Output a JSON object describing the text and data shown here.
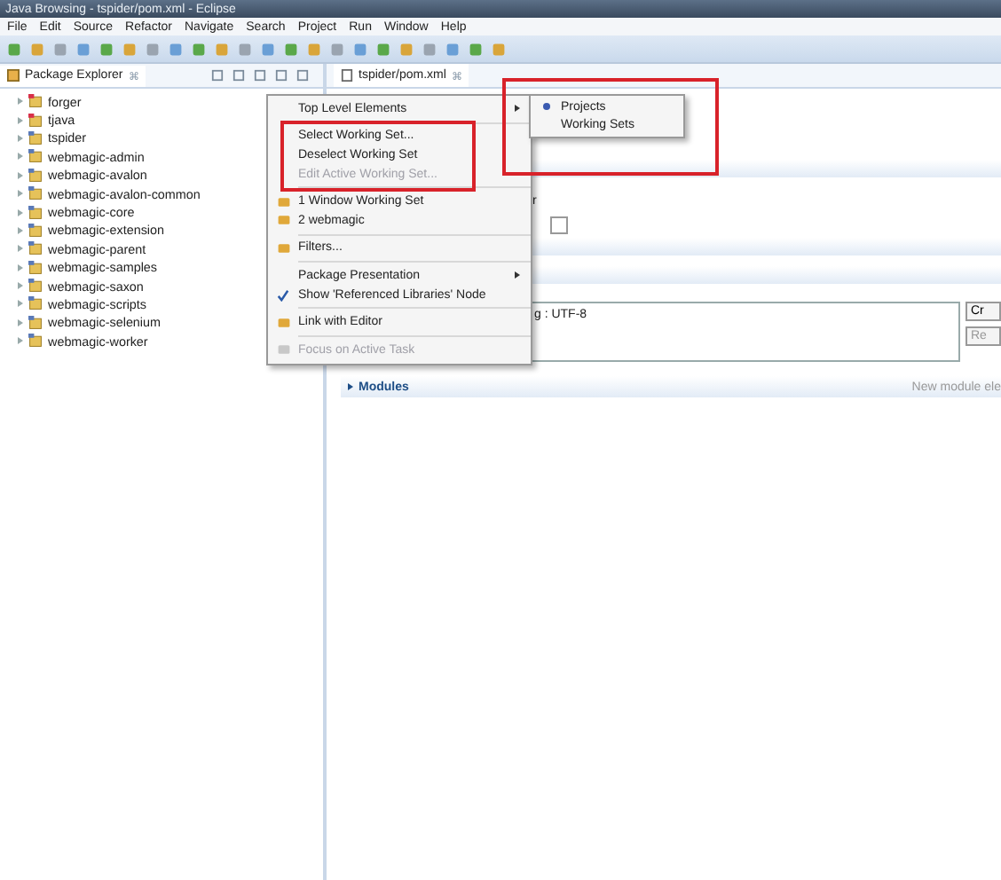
{
  "window": {
    "title": "Java Browsing - tspider/pom.xml - Eclipse"
  },
  "menubar": [
    "File",
    "Edit",
    "Source",
    "Refactor",
    "Navigate",
    "Search",
    "Project",
    "Run",
    "Window",
    "Help"
  ],
  "explorer": {
    "title": "Package Explorer",
    "close": "⌘",
    "items": [
      {
        "label": "forger",
        "error": true
      },
      {
        "label": "tjava",
        "error": true
      },
      {
        "label": "tspider",
        "error": false
      },
      {
        "label": "webmagic-admin",
        "error": false
      },
      {
        "label": "webmagic-avalon",
        "error": false
      },
      {
        "label": "webmagic-avalon-common",
        "error": false
      },
      {
        "label": "webmagic-core",
        "error": false
      },
      {
        "label": "webmagic-extension",
        "error": false
      },
      {
        "label": "webmagic-parent",
        "error": false
      },
      {
        "label": "webmagic-samples",
        "error": false
      },
      {
        "label": "webmagic-saxon",
        "error": false
      },
      {
        "label": "webmagic-scripts",
        "error": false
      },
      {
        "label": "webmagic-selenium",
        "error": false
      },
      {
        "label": "webmagic-worker",
        "error": false
      }
    ]
  },
  "editor": {
    "tab": "tspider/pom.xml",
    "close": "⌘",
    "fragment": "r",
    "encoding": "g : UTF-8",
    "buttons": [
      "Cr",
      "Re"
    ],
    "section": "Modules",
    "hint": "New module ele"
  },
  "menu": {
    "items": [
      {
        "kind": "submenu",
        "label": "Top Level Elements",
        "disabled": false
      },
      {
        "kind": "separator"
      },
      {
        "kind": "plain",
        "label": "Select Working Set...",
        "disabled": false
      },
      {
        "kind": "plain",
        "label": "Deselect Working Set",
        "disabled": false
      },
      {
        "kind": "plain",
        "label": "Edit Active Working Set...",
        "disabled": true
      },
      {
        "kind": "separator"
      },
      {
        "kind": "icon",
        "label": "1 Window Working Set",
        "disabled": false
      },
      {
        "kind": "icon",
        "label": "2 webmagic",
        "disabled": false
      },
      {
        "kind": "separator"
      },
      {
        "kind": "icon",
        "label": "Filters...",
        "disabled": false
      },
      {
        "kind": "separator"
      },
      {
        "kind": "submenu",
        "label": "Package Presentation",
        "disabled": false
      },
      {
        "kind": "check",
        "label": "Show 'Referenced Libraries' Node",
        "disabled": false,
        "checked": true
      },
      {
        "kind": "separator"
      },
      {
        "kind": "icon",
        "label": "Link with Editor",
        "disabled": false
      },
      {
        "kind": "separator"
      },
      {
        "kind": "icon",
        "label": "Focus on Active Task",
        "disabled": true
      }
    ]
  },
  "submenu": {
    "items": [
      {
        "label": "Projects",
        "selected": true
      },
      {
        "label": "Working Sets",
        "selected": false
      }
    ]
  }
}
